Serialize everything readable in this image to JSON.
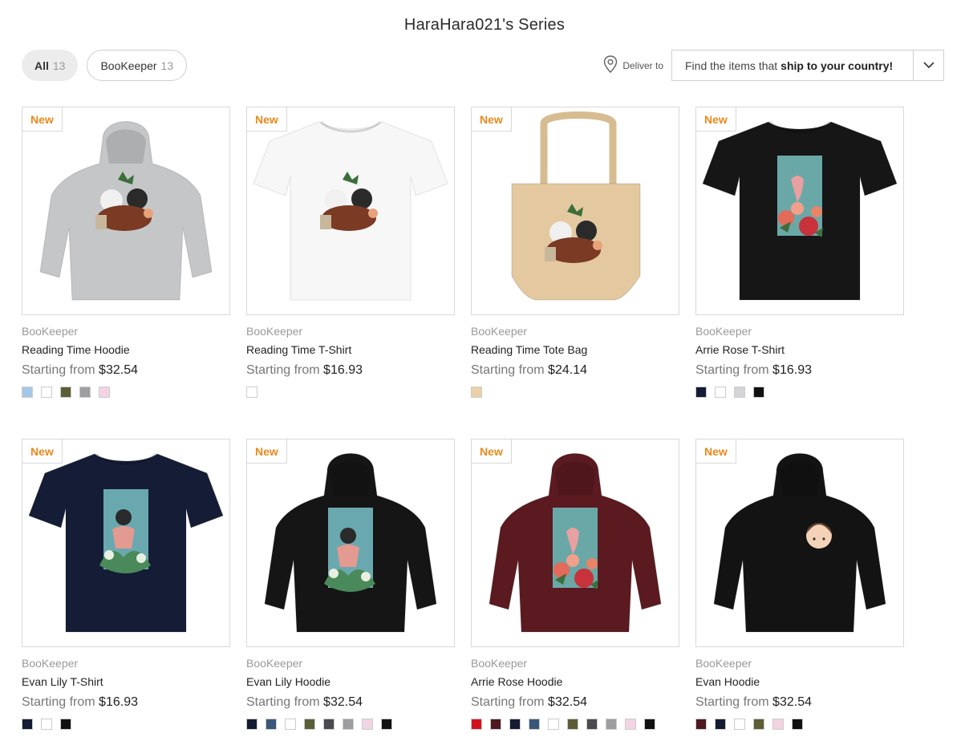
{
  "page": {
    "title": "HaraHara021's Series"
  },
  "filters": [
    {
      "label": "All",
      "count": "13"
    },
    {
      "label": "BooKeeper",
      "count": "13"
    }
  ],
  "deliver": {
    "label": "Deliver to",
    "text_prefix": "Find the items that",
    "text_bold": "ship to your country!"
  },
  "products": [
    {
      "badge": "New",
      "series": "BooKeeper",
      "name": "Reading Time Hoodie",
      "price_prefix": "Starting from",
      "price": "$32.54",
      "product_type": "hoodie",
      "product_color": "#c5c6c8",
      "art": "reading",
      "swatches": [
        "#a6c8e6",
        "#ffffff",
        "#5b5e37",
        "#9d9ea0",
        "#f3d4e2"
      ]
    },
    {
      "badge": "New",
      "series": "BooKeeper",
      "name": "Reading Time T-Shirt",
      "price_prefix": "Starting from",
      "price": "$16.93",
      "product_type": "tshirt",
      "product_color": "#f7f7f7",
      "art": "reading",
      "swatches": [
        "#ffffff"
      ]
    },
    {
      "badge": "New",
      "series": "BooKeeper",
      "name": "Reading Time Tote Bag",
      "price_prefix": "Starting from",
      "price": "$24.14",
      "product_type": "tote",
      "product_color": "#e4c9a0",
      "art": "reading",
      "swatches": [
        "#ecd0a8"
      ]
    },
    {
      "badge": "New",
      "series": "BooKeeper",
      "name": "Arrie Rose T-Shirt",
      "price_prefix": "Starting from",
      "price": "$16.93",
      "product_type": "tshirt",
      "product_color": "#161616",
      "art": "roses",
      "swatches": [
        "#141c33",
        "#ffffff",
        "#d4d5d7",
        "#111111"
      ]
    },
    {
      "badge": "New",
      "series": "BooKeeper",
      "name": "Evan Lily T-Shirt",
      "price_prefix": "Starting from",
      "price": "$16.93",
      "product_type": "tshirt",
      "product_color": "#151d36",
      "art": "lily",
      "swatches": [
        "#141c33",
        "#ffffff",
        "#111111"
      ]
    },
    {
      "badge": "New",
      "series": "BooKeeper",
      "name": "Evan Lily Hoodie",
      "price_prefix": "Starting from",
      "price": "$32.54",
      "product_type": "hoodie",
      "product_color": "#151515",
      "art": "lily",
      "swatches": [
        "#141c33",
        "#3a5678",
        "#ffffff",
        "#5b5e37",
        "#4a4a4f",
        "#9d9ea0",
        "#f3d4e2",
        "#111111"
      ]
    },
    {
      "badge": "New",
      "series": "BooKeeper",
      "name": "Arrie Rose Hoodie",
      "price_prefix": "Starting from",
      "price": "$32.54",
      "product_type": "hoodie",
      "product_color": "#5a1a20",
      "art": "roses",
      "swatches": [
        "#d4101e",
        "#4c1a1f",
        "#141c33",
        "#3a5678",
        "#ffffff",
        "#5b5e37",
        "#4a4a4f",
        "#9d9ea0",
        "#f3d4e2",
        "#111111"
      ]
    },
    {
      "badge": "New",
      "series": "BooKeeper",
      "name": "Evan Hoodie",
      "price_prefix": "Starting from",
      "price": "$32.54",
      "product_type": "hoodie",
      "product_color": "#131313",
      "art": "face",
      "swatches": [
        "#4c1a1f",
        "#141c33",
        "#ffffff",
        "#5b5e37",
        "#f3d4e2",
        "#111111"
      ]
    }
  ]
}
